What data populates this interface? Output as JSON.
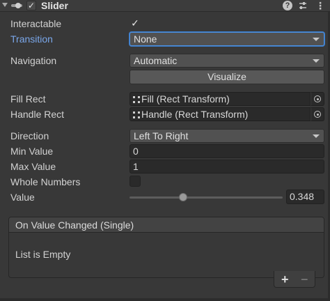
{
  "header": {
    "title": "Slider",
    "enabled_check": "✓",
    "help_symbol": "?",
    "menu_symbol": "⋮"
  },
  "fields": {
    "interactable": {
      "label": "Interactable",
      "check": "✓"
    },
    "transition": {
      "label": "Transition",
      "value": "None"
    },
    "navigation": {
      "label": "Navigation",
      "value": "Automatic"
    },
    "visualize_button": "Visualize",
    "fill_rect": {
      "label": "Fill Rect",
      "value": "Fill (Rect Transform)"
    },
    "handle_rect": {
      "label": "Handle Rect",
      "value": "Handle (Rect Transform)"
    },
    "direction": {
      "label": "Direction",
      "value": "Left To Right"
    },
    "min_value": {
      "label": "Min Value",
      "value": "0"
    },
    "max_value": {
      "label": "Max Value",
      "value": "1"
    },
    "whole_numbers": {
      "label": "Whole Numbers"
    },
    "value": {
      "label": "Value",
      "value": "0.348",
      "fraction": 0.348
    }
  },
  "event": {
    "title": "On Value Changed (Single)",
    "empty_text": "List is Empty",
    "add_symbol": "+",
    "remove_symbol": "−"
  },
  "colors": {
    "background": "#383838",
    "label_highlight": "#7aa7ea",
    "focus_border": "#4d8fdc"
  }
}
